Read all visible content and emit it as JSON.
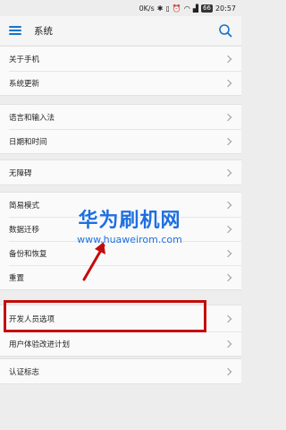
{
  "status_bar": {
    "speed": "0K/s",
    "icons": [
      "signal-icon",
      "bluetooth-icon",
      "vibrate-icon",
      "alarm-icon",
      "wifi-icon",
      "cell-signal-icon"
    ],
    "battery": "66",
    "time": "20:57"
  },
  "header": {
    "title": "系统"
  },
  "sections": [
    {
      "items": [
        {
          "label": "关于手机"
        },
        {
          "label": "系统更新"
        }
      ]
    },
    {
      "items": [
        {
          "label": "语言和输入法"
        },
        {
          "label": "日期和时间"
        }
      ]
    },
    {
      "items": [
        {
          "label": "无障碍"
        }
      ]
    },
    {
      "items": [
        {
          "label": "简易模式"
        },
        {
          "label": "数据迁移"
        },
        {
          "label": "备份和恢复"
        },
        {
          "label": "重置"
        }
      ]
    },
    {
      "items": [
        {
          "label": "开发人员选项"
        },
        {
          "label": "用户体验改进计划"
        }
      ]
    },
    {
      "items": [
        {
          "label": "认证标志"
        }
      ]
    }
  ],
  "watermark": {
    "title": "华为刷机网",
    "url": "www.huaweirom.com"
  },
  "colors": {
    "accent": "#1a73c8",
    "highlight": "#c40b0b",
    "watermark": "#1e6fe0"
  }
}
